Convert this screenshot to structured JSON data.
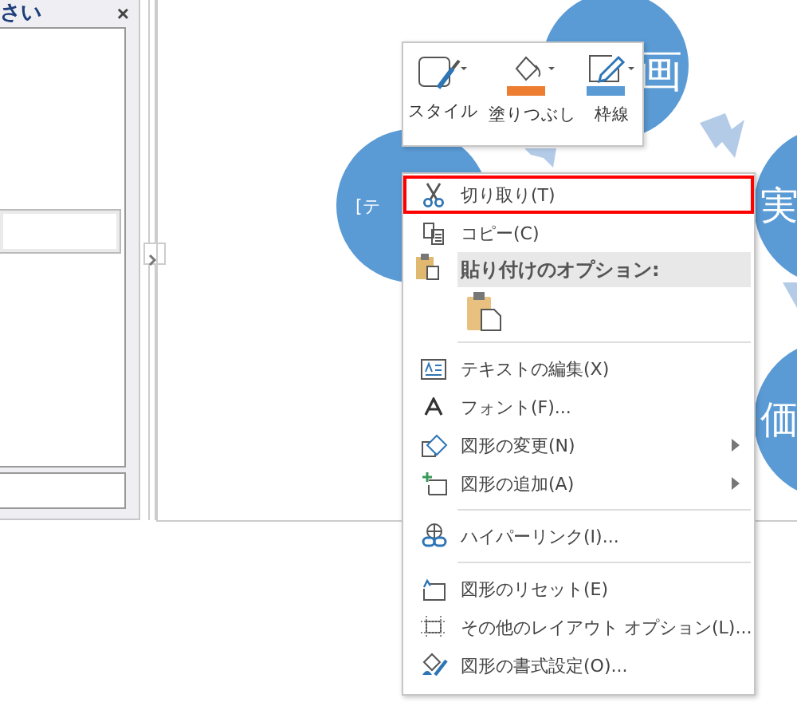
{
  "text_pane": {
    "title": "さい",
    "close": "×"
  },
  "diagram": {
    "nodes": [
      {
        "text": "画",
        "kind": "top"
      },
      {
        "text": "[テ",
        "kind": "left"
      },
      {
        "text": "実",
        "kind": "right"
      },
      {
        "text": "価",
        "kind": "bottom"
      }
    ]
  },
  "mini_toolbar": {
    "buttons": [
      {
        "label": "スタイル",
        "kind": "style"
      },
      {
        "label": "塗りつぶし",
        "kind": "fill"
      },
      {
        "label": "枠線",
        "kind": "outline"
      }
    ]
  },
  "context_menu": {
    "items": [
      {
        "kind": "item",
        "label": "切り取り(T)",
        "submenu": false,
        "selected": true
      },
      {
        "kind": "item",
        "label": "コピー(C)",
        "submenu": false,
        "selected": false
      },
      {
        "kind": "header",
        "label": "貼り付けのオプション:"
      },
      {
        "kind": "paste"
      },
      {
        "kind": "separator"
      },
      {
        "kind": "item",
        "label": "テキストの編集(X)",
        "submenu": false,
        "selected": false
      },
      {
        "kind": "item",
        "label": "フォント(F)...",
        "submenu": false,
        "selected": false
      },
      {
        "kind": "item",
        "label": "図形の変更(N)",
        "submenu": true,
        "selected": false
      },
      {
        "kind": "item",
        "label": "図形の追加(A)",
        "submenu": true,
        "selected": false
      },
      {
        "kind": "separator"
      },
      {
        "kind": "item",
        "label": "ハイパーリンク(I)...",
        "submenu": false,
        "selected": false
      },
      {
        "kind": "separator"
      },
      {
        "kind": "item",
        "label": "図形のリセット(E)",
        "submenu": false,
        "selected": false
      },
      {
        "kind": "item",
        "label": "その他のレイアウト オプション(L)...",
        "submenu": false,
        "selected": false
      },
      {
        "kind": "item",
        "label": "図形の書式設定(O)...",
        "submenu": false,
        "selected": false
      }
    ]
  }
}
